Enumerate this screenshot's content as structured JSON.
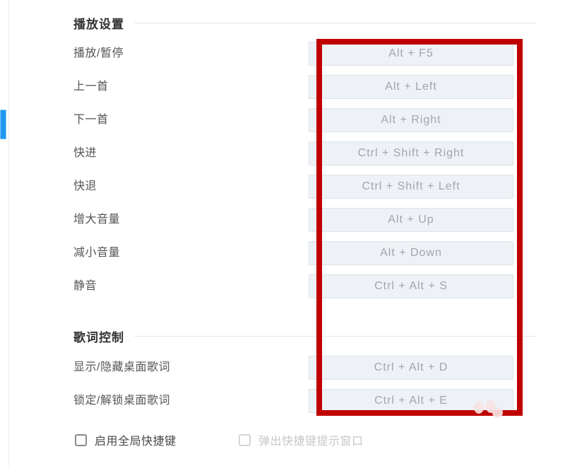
{
  "scrollbar": {
    "thumb_color": "#2196f3"
  },
  "annotation": {
    "color": "#c00000",
    "shape": "rectangle-highlight"
  },
  "sections": [
    {
      "id": "playback",
      "title": "播放设置",
      "rows": [
        {
          "label": "播放/暂停",
          "shortcut": "Alt + F5"
        },
        {
          "label": "上一首",
          "shortcut": "Alt + Left"
        },
        {
          "label": "下一首",
          "shortcut": "Alt + Right"
        },
        {
          "label": "快进",
          "shortcut": "Ctrl + Shift + Right"
        },
        {
          "label": "快退",
          "shortcut": "Ctrl + Shift + Left"
        },
        {
          "label": "增大音量",
          "shortcut": "Alt + Up"
        },
        {
          "label": "减小音量",
          "shortcut": "Alt + Down"
        },
        {
          "label": "静音",
          "shortcut": "Ctrl + Alt + S"
        }
      ]
    },
    {
      "id": "lyrics",
      "title": "歌词控制",
      "rows": [
        {
          "label": "显示/隐藏桌面歌词",
          "shortcut": "Ctrl + Alt + D"
        },
        {
          "label": "锁定/解锁桌面歌词",
          "shortcut": "Ctrl + Alt + E"
        }
      ]
    }
  ],
  "footer": {
    "checkboxes": [
      {
        "label": "启用全局快捷键",
        "checked": false,
        "disabled": false
      },
      {
        "label": "弹出快捷键提示窗口",
        "checked": false,
        "disabled": true
      }
    ]
  }
}
